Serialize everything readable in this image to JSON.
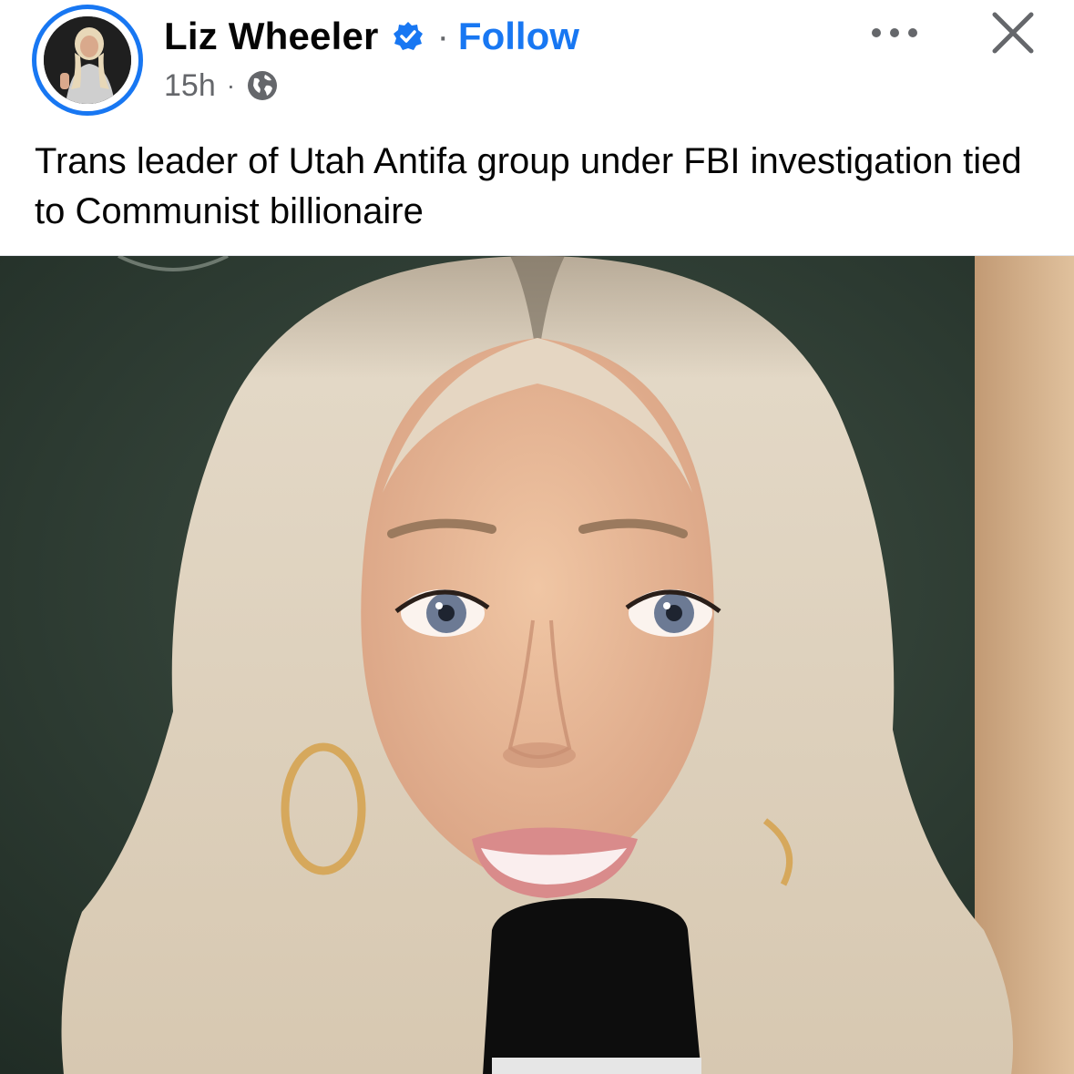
{
  "post": {
    "author_name": "Liz Wheeler",
    "separator": "·",
    "follow_label": "Follow",
    "timestamp": "15h",
    "meta_separator": "·",
    "privacy_icon": "globe-icon",
    "verified_icon": "verified-badge-icon",
    "more_icon": "more-options-icon",
    "close_icon": "close-icon",
    "caption": "Trans leader of Utah Antifa group under FBI investigation tied to Communist billionaire"
  },
  "colors": {
    "accent": "#1877f2",
    "text": "#050505",
    "secondary_text": "#65676b"
  }
}
